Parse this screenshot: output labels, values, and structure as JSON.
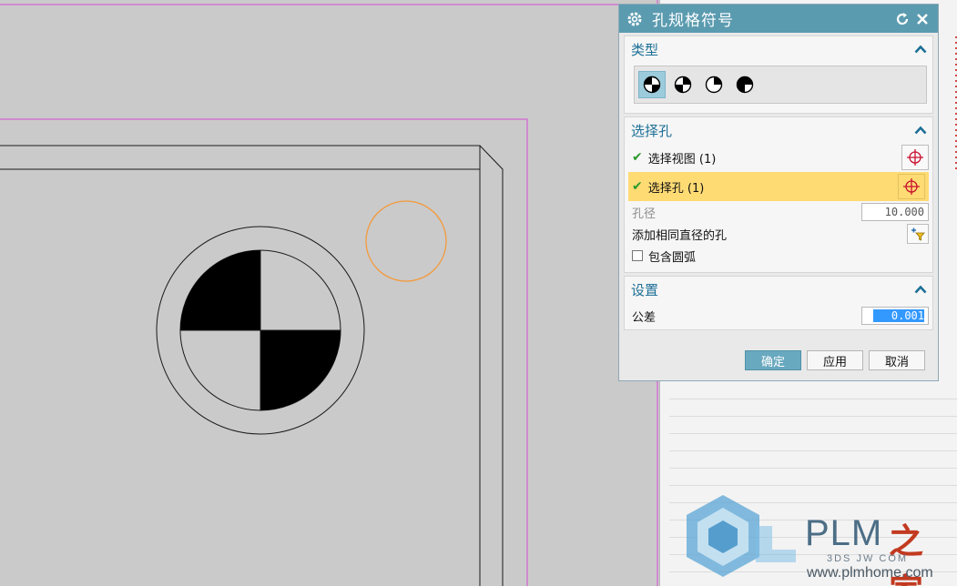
{
  "dialog": {
    "title": "孔规格符号",
    "sections": {
      "type": {
        "header": "类型"
      },
      "select_hole": {
        "header": "选择孔",
        "select_view": "选择视图 (1)",
        "select_hole": "选择孔 (1)",
        "diameter_label": "孔径",
        "diameter_value": "10.000",
        "add_same_diameter": "添加相同直径的孔",
        "include_arc": "包含圆弧"
      },
      "settings": {
        "header": "设置",
        "tolerance_label": "公差",
        "tolerance_value": "0.001"
      }
    },
    "buttons": {
      "ok": "确定",
      "apply": "应用",
      "cancel": "取消"
    }
  },
  "watermark": {
    "brand": "PLM",
    "brand_cn": "之家",
    "sub": "3DS  JW  COM",
    "url": "www.plmhome.com"
  },
  "colors": {
    "titlebar": "#5b9bb0",
    "section_header": "#1c6f96",
    "highlight_row": "#ffdb74",
    "primary_button": "#69a9bf",
    "selection_blue": "#3399ff",
    "orange_circle": "#f39a3c",
    "magenta_border": "#d64ad6"
  }
}
